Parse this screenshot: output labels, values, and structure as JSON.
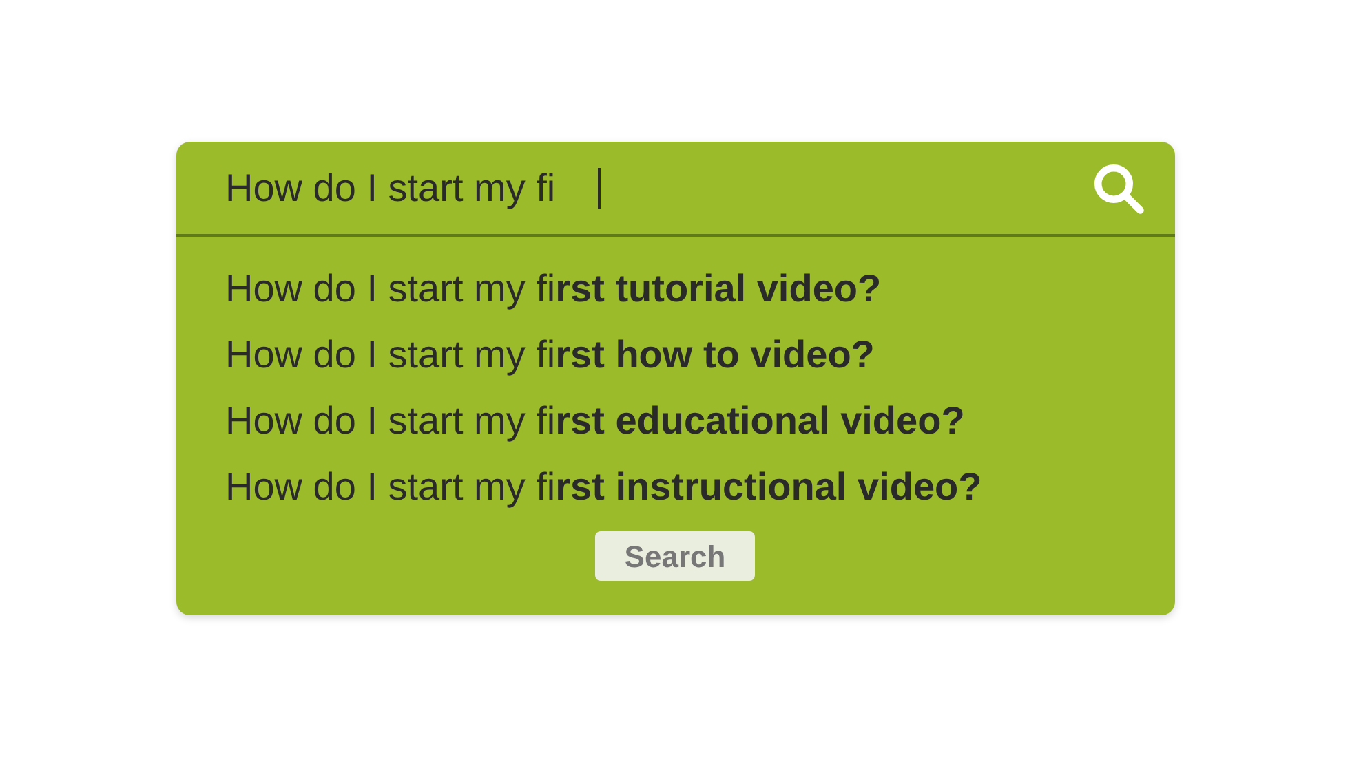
{
  "search": {
    "value": "How do I start my fi"
  },
  "suggestions": [
    {
      "text": "How do I start my fi**rst tutorial video?**"
    },
    {
      "text": "How do I start my fi**rst how to video?**"
    },
    {
      "text": "How do I start my fi**rst educational video?**"
    },
    {
      "text": "How do I start my fi**rst instructional video?**"
    }
  ],
  "button": "Search"
}
